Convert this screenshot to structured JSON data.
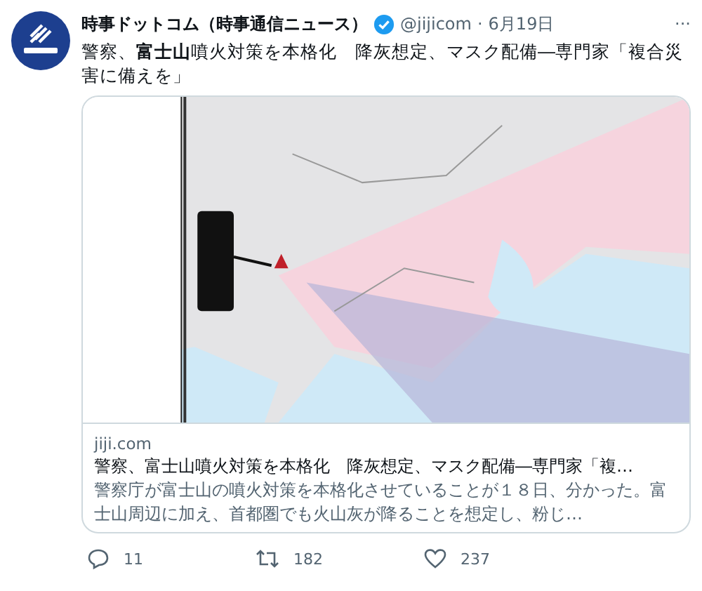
{
  "author": {
    "name": "時事ドットコム（時事通信ニュース）",
    "verified": true,
    "handle": "@jijicom",
    "separator": "·",
    "date": "6月19日",
    "more": "···"
  },
  "tweet": {
    "text": "警察、**富士山**噴火対策を本格化　降灰想定、マスク配備―専門家「複合災害に備えを」"
  },
  "card": {
    "site": "jiji.com",
    "title": "警察、富士山噴火対策を本格化　降灰想定、マスク配備―専門家「複…",
    "description": "警察庁が富士山の噴火対策を本格化させていることが１８日、分かった。富士山周辺に加え、首都圏でも火山灰が降ることを想定し、粉じ…"
  },
  "actions": [
    {
      "kind": "reply",
      "count": "11"
    },
    {
      "kind": "retweet",
      "count": "182"
    },
    {
      "kind": "like",
      "count": "237"
    }
  ]
}
